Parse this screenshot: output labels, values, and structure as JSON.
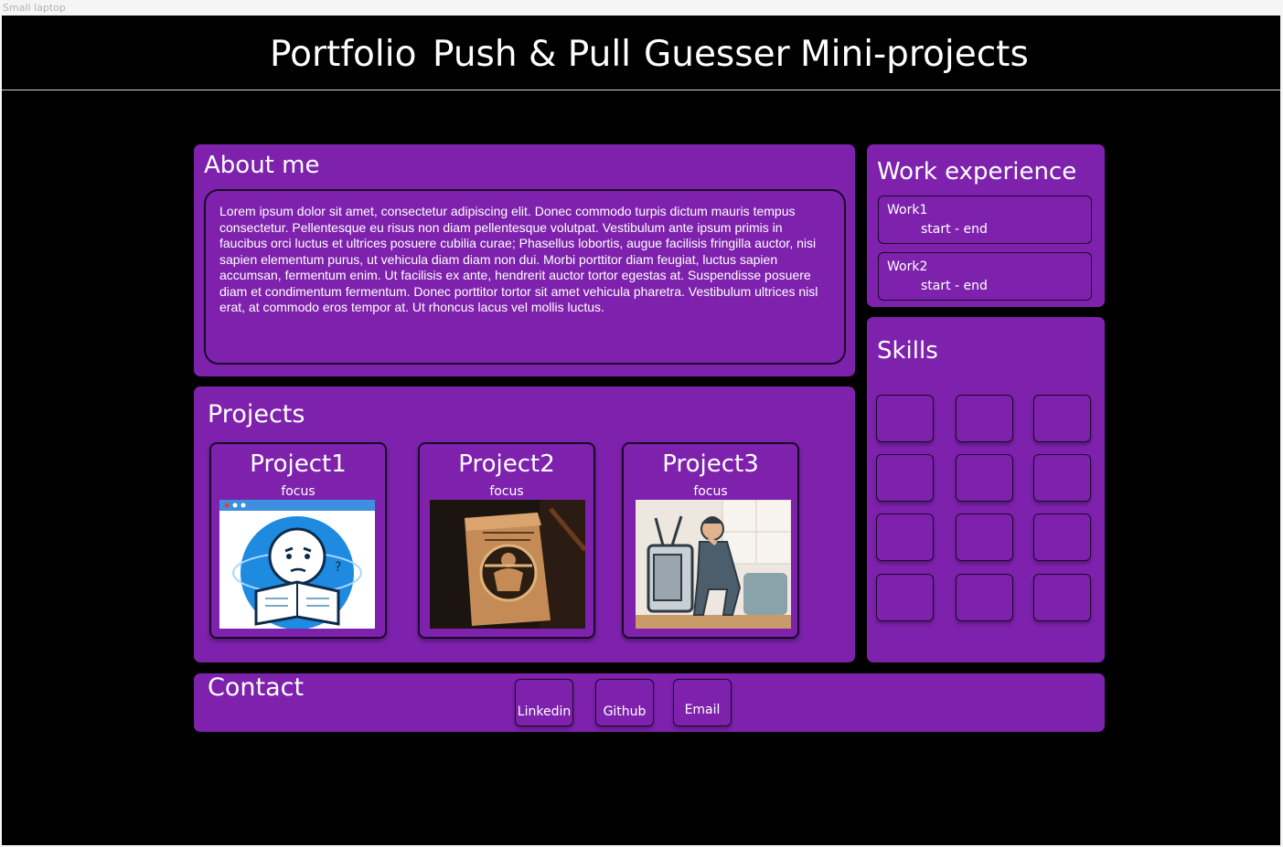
{
  "frame_label": "Small laptop",
  "nav": {
    "items": [
      "Portfolio",
      "Push & Pull",
      "Guesser",
      "Mini-projects"
    ]
  },
  "about": {
    "title": "About me",
    "text": "Lorem ipsum dolor sit amet, consectetur adipiscing elit. Donec commodo turpis dictum mauris tempus consectetur. Pellentesque eu risus non diam pellentesque volutpat. Vestibulum ante ipsum primis in faucibus orci luctus et ultrices posuere cubilia curae; Phasellus lobortis, augue facilisis fringilla auctor, nisi sapien elementum purus, ut vehicula diam diam non dui. Morbi porttitor diam feugiat, luctus sapien accumsan, fermentum enim. Ut facilisis ex ante, hendrerit auctor tortor egestas at. Suspendisse posuere diam et condimentum fermentum. Donec porttitor tortor sit amet vehicula pharetra. Vestibulum ultrices nisl erat, at commodo eros tempor at. Ut rhoncus lacus vel mollis luctus."
  },
  "work": {
    "title": "Work experience",
    "items": [
      {
        "name": "Work1",
        "dates": "start - end"
      },
      {
        "name": "Work2",
        "dates": "start - end"
      }
    ]
  },
  "skills": {
    "title": "Skills",
    "count": 12
  },
  "projects": {
    "title": "Projects",
    "items": [
      {
        "title": "Project1",
        "focus": "focus",
        "image_icon": "confused-reader-illustration"
      },
      {
        "title": "Project2",
        "focus": "focus",
        "image_icon": "muscle-box-illustration"
      },
      {
        "title": "Project3",
        "focus": "focus",
        "image_icon": "man-with-tv-illustration"
      }
    ]
  },
  "contact": {
    "title": "Contact",
    "buttons": [
      "Linkedin",
      "Github",
      "Email"
    ]
  },
  "colors": {
    "background": "#000000",
    "panel": "#7e22ae",
    "border": "#1c0829",
    "text": "#ffffff"
  }
}
